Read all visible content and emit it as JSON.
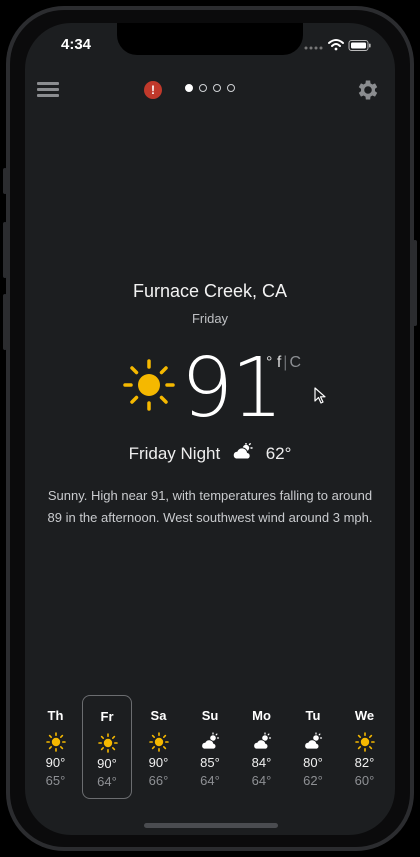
{
  "status": {
    "time": "4:34"
  },
  "nav": {
    "menu_icon": "hamburger-menu-icon",
    "alert_icon": "alert-exclamation-icon",
    "alert_symbol": "!",
    "page_count": 4,
    "active_page": 1,
    "settings_icon": "gear-icon"
  },
  "current": {
    "location": "Furnace Creek, CA",
    "day": "Friday",
    "condition_icon": "sun-icon",
    "temperature": "91",
    "unit_f": "° f",
    "unit_sep": "|",
    "unit_c": "C"
  },
  "tonight": {
    "label": "Friday Night",
    "icon": "partly-cloudy-night-icon",
    "low": "62°"
  },
  "description": "Sunny. High near 91, with temperatures falling to around 89 in the afternoon. West southwest wind around 3 mph.",
  "forecast": [
    {
      "day": "Th",
      "icon": "sun-icon",
      "hi": "90°",
      "lo": "65°"
    },
    {
      "day": "Fr",
      "icon": "sun-icon",
      "hi": "90°",
      "lo": "64°",
      "selected": true
    },
    {
      "day": "Sa",
      "icon": "sun-icon",
      "hi": "90°",
      "lo": "66°"
    },
    {
      "day": "Su",
      "icon": "partly-cloudy-icon",
      "hi": "85°",
      "lo": "64°"
    },
    {
      "day": "Mo",
      "icon": "partly-cloudy-icon",
      "hi": "84°",
      "lo": "64°"
    },
    {
      "day": "Tu",
      "icon": "partly-cloudy-icon",
      "hi": "80°",
      "lo": "62°"
    },
    {
      "day": "We",
      "icon": "sun-icon",
      "hi": "82°",
      "lo": "60°"
    }
  ],
  "colors": {
    "background": "#1c1e20",
    "sun": "#f5b800",
    "alert": "#c0392b",
    "text": "#f2f2f2",
    "muted": "#8e9094"
  }
}
